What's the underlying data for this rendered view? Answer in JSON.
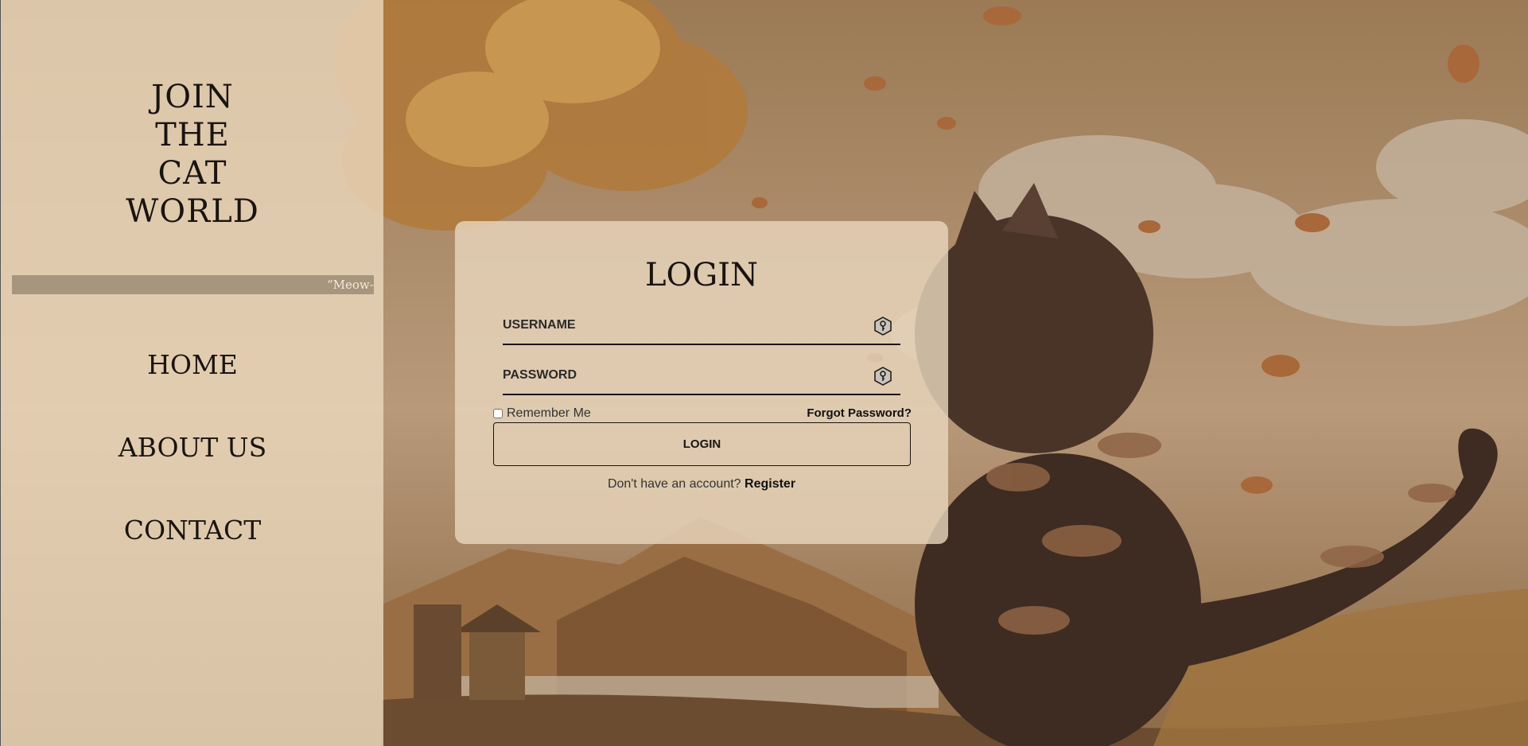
{
  "sidebar": {
    "brand_lines": [
      "JOIN",
      "THE",
      "CAT",
      "WORLD"
    ],
    "ticker_text": "“Meow-w",
    "nav": [
      {
        "label": "HOME"
      },
      {
        "label": "ABOUT US"
      },
      {
        "label": "CONTACT"
      }
    ]
  },
  "login": {
    "title": "LOGIN",
    "username_placeholder": "USERNAME",
    "password_placeholder": "PASSWORD",
    "remember_label": "Remember Me",
    "forgot_label": "Forgot Password?",
    "button_label": "LOGIN",
    "no_account_text": "Don't have an account?",
    "register_label": "Register"
  },
  "icons": {
    "username_icon": "key-hexagon-icon",
    "password_icon": "key-hexagon-icon"
  },
  "colors": {
    "sidebar_bg": "#ecdabe",
    "card_bg": "#e8d6bc",
    "text_dark": "#1a1410"
  }
}
